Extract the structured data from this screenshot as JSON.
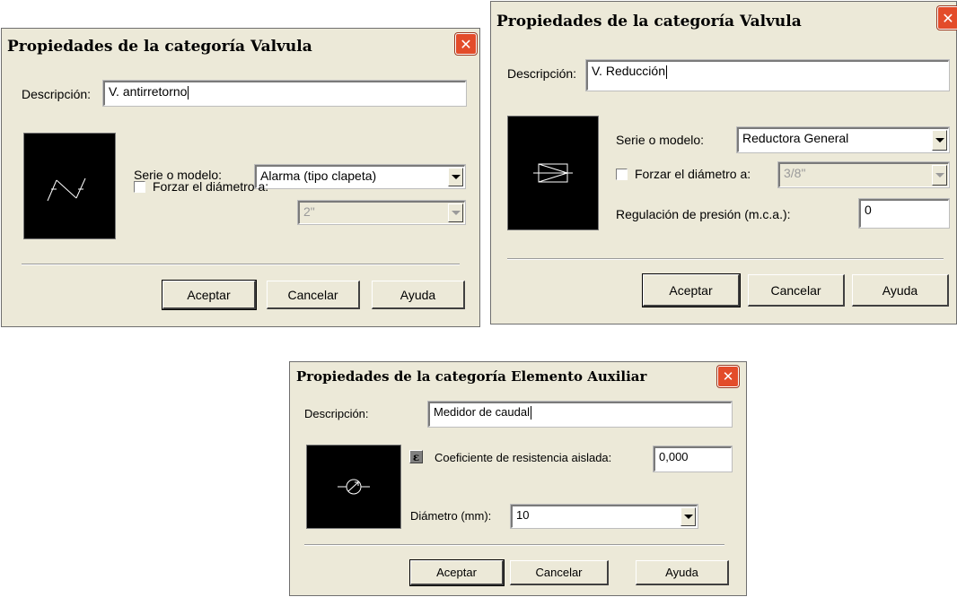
{
  "dialog1": {
    "title": "Propiedades de la categoría Valvula",
    "descripcion_label": "Descripción:",
    "descripcion_value": "V. antirretorno",
    "serie_label": "Serie o modelo:",
    "serie_value": "Alarma (tipo clapeta)",
    "forzar_label": "Forzar el diámetro a:",
    "forzar_checked": false,
    "diametro_value": "2\"",
    "preview_icon": "check-valve-icon",
    "buttons": {
      "aceptar": "Aceptar",
      "cancelar": "Cancelar",
      "ayuda": "Ayuda"
    }
  },
  "dialog2": {
    "title": "Propiedades de la categoría Valvula",
    "descripcion_label": "Descripción:",
    "descripcion_value": "V. Reducción",
    "serie_label": "Serie o modelo:",
    "serie_value": "Reductora General",
    "forzar_label": "Forzar el diámetro a:",
    "forzar_checked": false,
    "diametro_value": "3/8\"",
    "regulacion_label": "Regulación de presión (m.c.a.):",
    "regulacion_value": "0",
    "preview_icon": "pressure-reducing-valve-icon",
    "buttons": {
      "aceptar": "Aceptar",
      "cancelar": "Cancelar",
      "ayuda": "Ayuda"
    }
  },
  "dialog3": {
    "title": "Propiedades de la categoría Elemento Auxiliar",
    "descripcion_label": "Descripción:",
    "descripcion_value": "Medidor de caudal",
    "eps_symbol": "ε",
    "coeficiente_label": "Coeficiente de resistencia aislada:",
    "coeficiente_value": "0,000",
    "diametro_label": "Diámetro (mm):",
    "diametro_value": "10",
    "preview_icon": "flow-meter-icon",
    "buttons": {
      "aceptar": "Aceptar",
      "cancelar": "Cancelar",
      "ayuda": "Ayuda"
    }
  },
  "colors": {
    "dialog_bg": "#ece9d8",
    "close_button": "#e34c2a",
    "preview_bg": "#000000"
  }
}
